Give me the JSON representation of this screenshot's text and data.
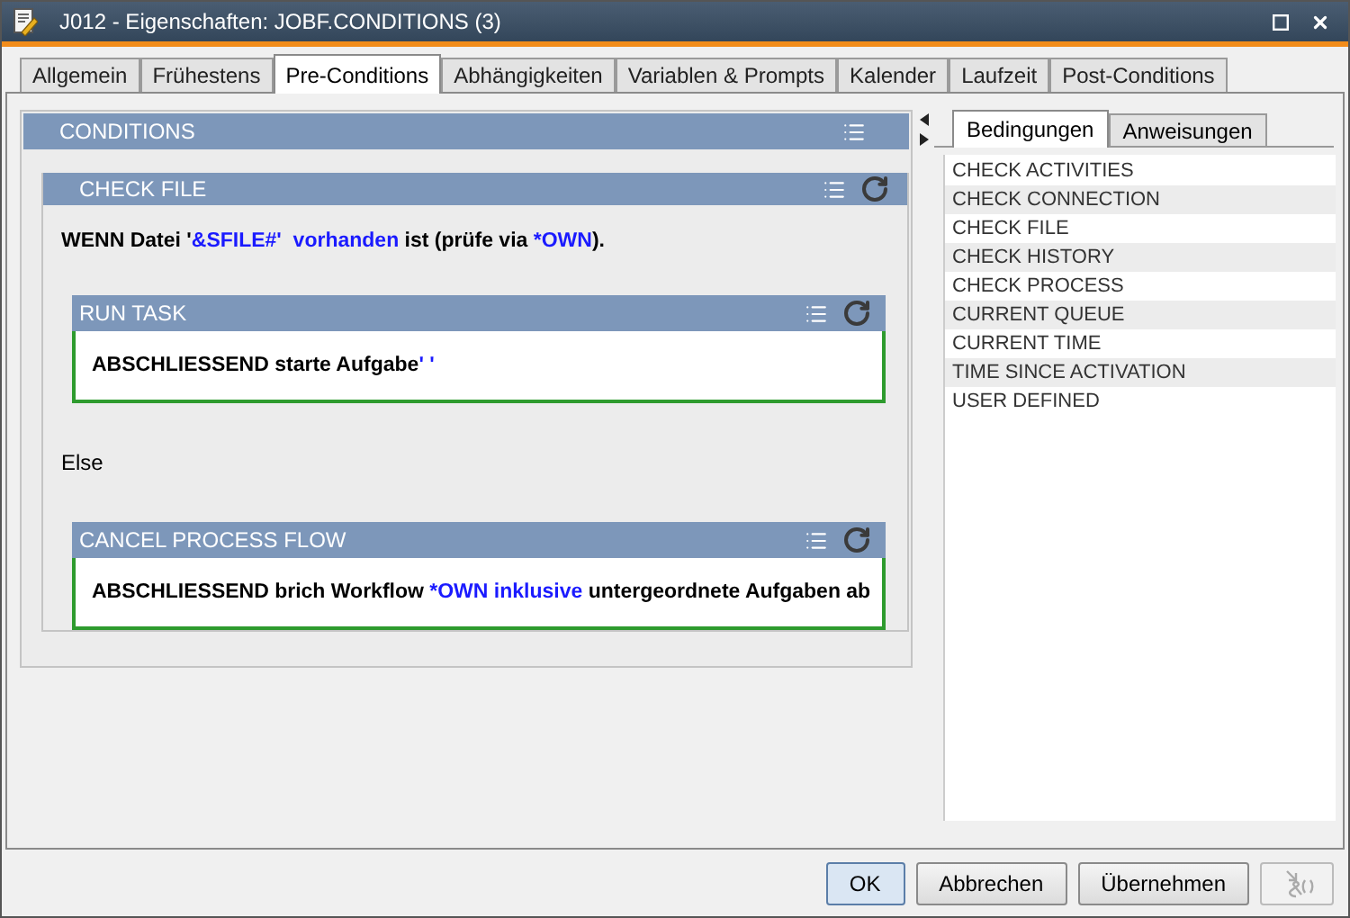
{
  "window": {
    "title": "J012 - Eigenschaften: JOBF.CONDITIONS (3)"
  },
  "tabs": [
    {
      "label": "Allgemein",
      "selected": false
    },
    {
      "label": "Frühestens",
      "selected": false
    },
    {
      "label": "Pre-Conditions",
      "selected": true
    },
    {
      "label": "Abhängigkeiten",
      "selected": false
    },
    {
      "label": "Variablen & Prompts",
      "selected": false
    },
    {
      "label": "Kalender",
      "selected": false
    },
    {
      "label": "Laufzeit",
      "selected": false
    },
    {
      "label": "Post-Conditions",
      "selected": false
    }
  ],
  "conditions": {
    "title": "CONDITIONS",
    "block": {
      "title": "CHECK FILE",
      "statement": [
        {
          "kind": "text",
          "text": "WENN Datei '"
        },
        {
          "kind": "keyword",
          "text": "&SFILE#'  vorhanden"
        },
        {
          "kind": "text",
          "text": " ist (prüfe via "
        },
        {
          "kind": "keyword",
          "text": "*OWN"
        },
        {
          "kind": "text",
          "text": ")."
        }
      ],
      "then_block": {
        "title": "RUN TASK",
        "statement": [
          {
            "kind": "text",
            "text": "ABSCHLIESSEND starte Aufgabe"
          },
          {
            "kind": "keyword",
            "text": "' '"
          }
        ]
      },
      "else_label": "Else",
      "else_block": {
        "title": "CANCEL PROCESS FLOW",
        "statement": [
          {
            "kind": "text",
            "text": "ABSCHLIESSEND brich Workflow "
          },
          {
            "kind": "keyword",
            "text": "*OWN inklusive"
          },
          {
            "kind": "text",
            "text": " untergeordnete Aufgaben ab"
          }
        ]
      }
    }
  },
  "side_tabs": [
    {
      "label": "Bedingungen",
      "selected": true
    },
    {
      "label": "Anweisungen",
      "selected": false
    }
  ],
  "side_list": [
    "CHECK ACTIVITIES",
    "CHECK CONNECTION",
    "CHECK FILE",
    "CHECK HISTORY",
    "CHECK PROCESS",
    "CURRENT QUEUE",
    "CURRENT TIME",
    "TIME SINCE ACTIVATION",
    "USER DEFINED"
  ],
  "buttons": [
    {
      "kind": "text",
      "label": "OK",
      "default": true,
      "disabled": false
    },
    {
      "kind": "text",
      "label": "Abbrechen",
      "default": false,
      "disabled": false
    },
    {
      "kind": "text",
      "label": "Übernehmen",
      "default": false,
      "disabled": false
    },
    {
      "kind": "icon",
      "default": false,
      "disabled": true
    }
  ]
}
